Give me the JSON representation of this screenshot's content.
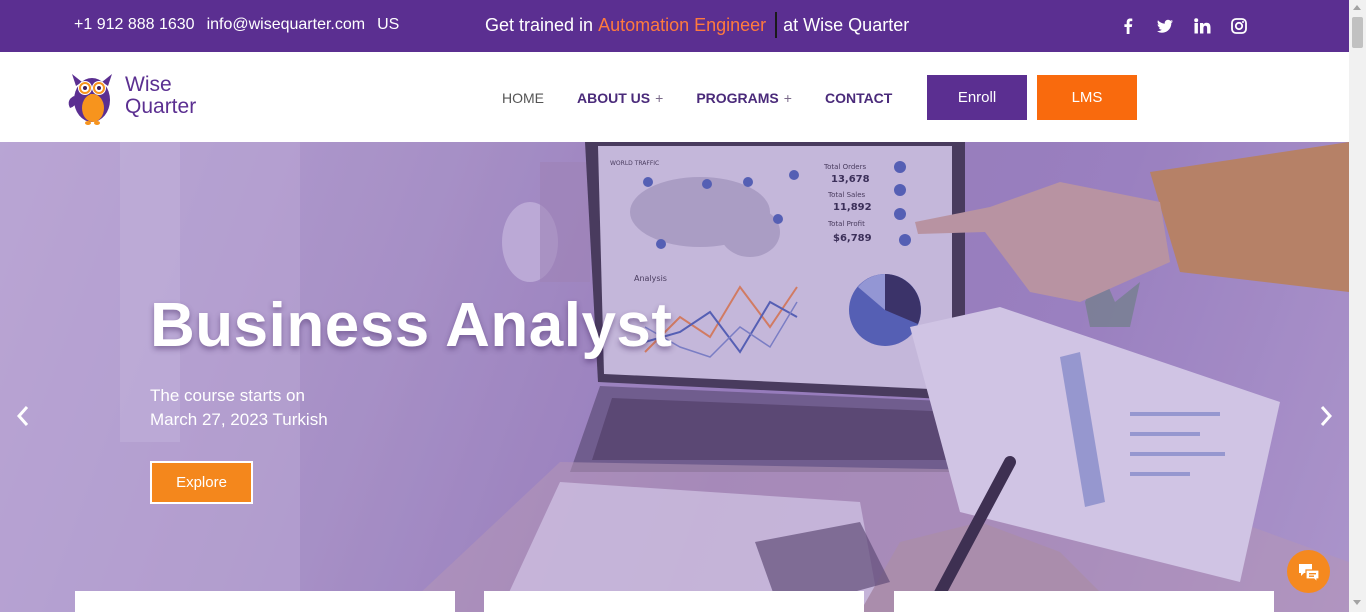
{
  "topbar": {
    "phone": "+1 912 888 1630",
    "email": "info@wisequarter.com",
    "region": "US",
    "promo_prefix": "Get trained in",
    "promo_highlight": "Automation Engineer",
    "promo_suffix": "at Wise Quarter",
    "social_icons": [
      "facebook-icon",
      "twitter-icon",
      "linkedin-icon",
      "instagram-icon"
    ]
  },
  "header": {
    "logo_line1": "Wise",
    "logo_line2": "Quarter",
    "nav": [
      {
        "label": "HOME",
        "has_submenu": false
      },
      {
        "label": "ABOUT US",
        "has_submenu": true
      },
      {
        "label": "PROGRAMS",
        "has_submenu": true
      },
      {
        "label": "CONTACT",
        "has_submenu": false
      }
    ],
    "submenu_symbol": "+",
    "enroll_label": "Enroll",
    "lms_label": "LMS"
  },
  "hero": {
    "title": "Business Analyst",
    "subtitle_line1": "The course starts on",
    "subtitle_line2": "March 27, 2023 Turkish",
    "explore_label": "Explore",
    "dashboard": {
      "panel_title": "WORLD TRAFFIC",
      "orders_label": "Total Orders",
      "orders_value": "13,678",
      "sales_label": "Total Sales",
      "sales_value": "11,892",
      "profit_label": "Total Profit",
      "profit_value": "$6,789",
      "analysis_label": "Analysis"
    }
  },
  "colors": {
    "brand_purple": "#5b2f91",
    "accent_orange": "#f96a0d",
    "promo_highlight": "#ff7a3d",
    "explore_orange": "#f4871c"
  }
}
